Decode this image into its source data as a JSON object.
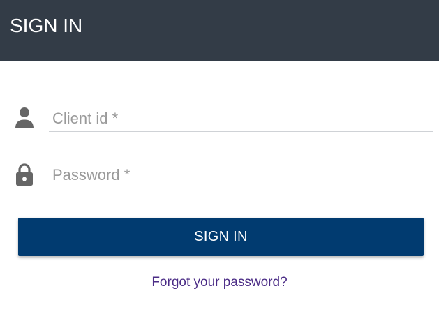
{
  "header": {
    "title": "SIGN IN"
  },
  "form": {
    "client_id": {
      "placeholder": "Client id *",
      "value": "",
      "icon": "person-icon"
    },
    "password": {
      "placeholder": "Password *",
      "value": "",
      "icon": "lock-icon"
    },
    "submit_label": "SIGN IN",
    "forgot_link": "Forgot your password?"
  },
  "colors": {
    "header_bg": "#333c47",
    "button_bg": "#013b70",
    "link": "#4b2c86",
    "icon": "#666666"
  }
}
